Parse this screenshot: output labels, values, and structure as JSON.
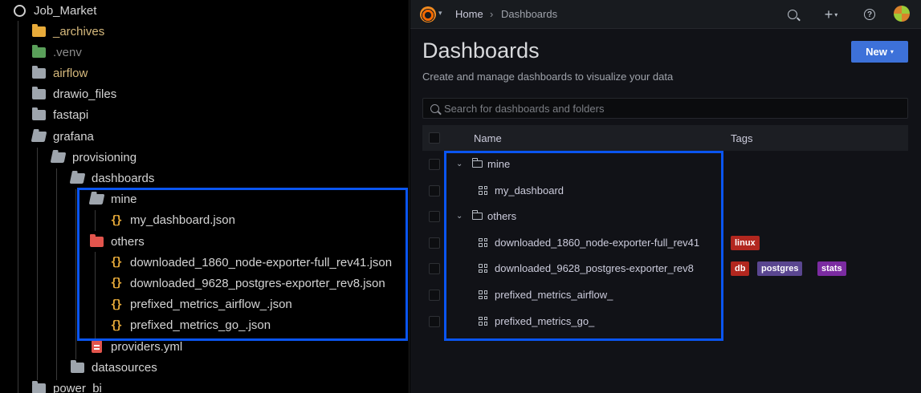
{
  "explorer": {
    "root_label": "Job_Market",
    "items": [
      {
        "label": "_archives",
        "icon": "archive-folder-icon",
        "color": "#d7ba7d"
      },
      {
        "label": ".venv",
        "icon": "venv-folder-icon",
        "color": "#8b8b8b"
      },
      {
        "label": "airflow",
        "icon": "folder-icon",
        "color": "#d7ba7d"
      },
      {
        "label": "drawio_files",
        "icon": "folder-icon",
        "color": "#d4d4d4"
      },
      {
        "label": "fastapi",
        "icon": "folder-icon",
        "color": "#d4d4d4"
      },
      {
        "label": "grafana",
        "icon": "folder-open-icon",
        "color": "#d4d4d4"
      },
      {
        "label": "provisioning",
        "icon": "folder-open-icon",
        "color": "#d4d4d4"
      },
      {
        "label": "dashboards",
        "icon": "folder-open-icon",
        "color": "#d4d4d4"
      },
      {
        "label": "mine",
        "icon": "folder-open-icon",
        "color": "#d4d4d4"
      },
      {
        "label": "my_dashboard.json",
        "icon": "json-file-icon",
        "color": "#d4d4d4"
      },
      {
        "label": "others",
        "icon": "folder-special-icon",
        "color": "#d4d4d4"
      },
      {
        "label": "downloaded_1860_node-exporter-full_rev41.json",
        "icon": "json-file-icon",
        "color": "#d4d4d4"
      },
      {
        "label": "downloaded_9628_postgres-exporter_rev8.json",
        "icon": "json-file-icon",
        "color": "#d4d4d4"
      },
      {
        "label": "prefixed_metrics_airflow_.json",
        "icon": "json-file-icon",
        "color": "#d4d4d4"
      },
      {
        "label": "prefixed_metrics_go_.json",
        "icon": "json-file-icon",
        "color": "#d4d4d4"
      },
      {
        "label": "providers.yml",
        "icon": "yml-file-icon",
        "color": "#d4d4d4"
      },
      {
        "label": "datasources",
        "icon": "folder-icon",
        "color": "#d4d4d4"
      },
      {
        "label": "power_bi",
        "icon": "folder-icon",
        "color": "#d4d4d4"
      }
    ]
  },
  "grafana": {
    "breadcrumb": [
      "Home",
      "Dashboards"
    ],
    "breadcrumb_sep": "›",
    "title": "Dashboards",
    "subtitle": "Create and manage dashboards to visualize your data",
    "new_button": "New",
    "search_placeholder": "Search for dashboards and folders",
    "columns": {
      "name": "Name",
      "tags": "Tags"
    },
    "rows": [
      {
        "type": "folder",
        "name": "mine",
        "tags": []
      },
      {
        "type": "dashboard",
        "name": "my_dashboard",
        "tags": []
      },
      {
        "type": "folder",
        "name": "others",
        "tags": []
      },
      {
        "type": "dashboard",
        "name": "downloaded_1860_node-exporter-full_rev41",
        "tags": [
          {
            "label": "linux",
            "color": "#b2271f"
          }
        ]
      },
      {
        "type": "dashboard",
        "name": "downloaded_9628_postgres-exporter_rev8",
        "tags": [
          {
            "label": "db",
            "color": "#b2271f"
          },
          {
            "label": "postgres",
            "color": "#5a4690"
          },
          {
            "label": "stats",
            "color": "#7b2ba1"
          }
        ]
      },
      {
        "type": "dashboard",
        "name": "prefixed_metrics_airflow_",
        "tags": []
      },
      {
        "type": "dashboard",
        "name": "prefixed_metrics_go_",
        "tags": []
      }
    ],
    "accent_color": "#3d71d9",
    "highlight_color": "#0a55f1"
  }
}
